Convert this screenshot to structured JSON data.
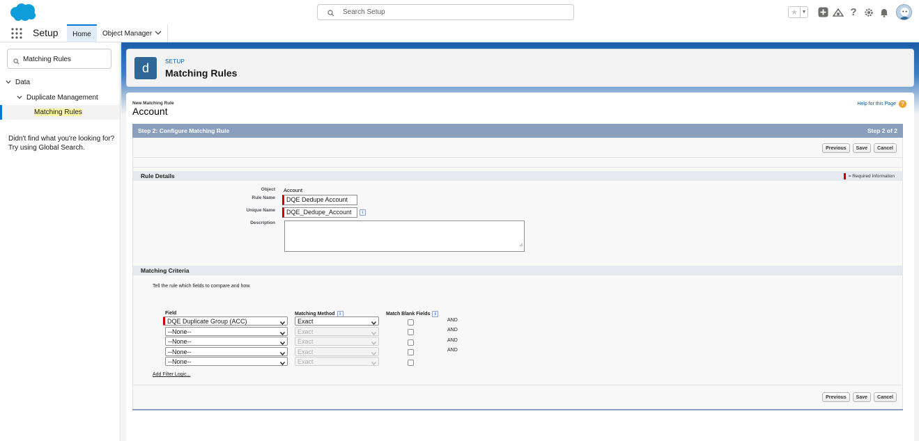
{
  "header": {
    "search_placeholder": "Search Setup"
  },
  "context_bar": {
    "app_name": "Setup",
    "tabs": [
      {
        "label": "Home",
        "active": true
      },
      {
        "label": "Object Manager",
        "active": false
      }
    ]
  },
  "sidebar": {
    "quick_find_value": "Matching Rules",
    "tree": {
      "data_label": "Data",
      "duplicate_management_label": "Duplicate Management",
      "matching_rules_label": "Matching Rules"
    },
    "no_results_help": "Didn't find what you're looking for? Try using Global Search."
  },
  "page_header": {
    "icon_letter": "d",
    "eyebrow": "SETUP",
    "title": "Matching Rules"
  },
  "classic": {
    "subtitle": "New Matching Rule",
    "title": "Account",
    "help_link": "Help for this Page",
    "step_title": "Step 2: Configure Matching Rule",
    "step_count": "Step 2 of 2",
    "buttons": {
      "previous": "Previous",
      "save": "Save",
      "cancel": "Cancel"
    },
    "rule_details": {
      "section_title": "Rule Details",
      "required_legend": "= Required Information",
      "object_label": "Object",
      "object_value": "Account",
      "rule_name_label": "Rule Name",
      "rule_name_value": "DQE Dedupe Account",
      "unique_name_label": "Unique Name",
      "unique_name_value": "DQE_Dedupe_Account",
      "description_label": "Description",
      "description_value": ""
    },
    "matching_criteria": {
      "section_title": "Matching Criteria",
      "intro": "Tell the rule which fields to compare and how.",
      "col_field": "Field",
      "col_method": "Matching Method",
      "col_blank": "Match Blank Fields",
      "rows": [
        {
          "field": "DQE Duplicate Group (ACC)",
          "method": "Exact",
          "match_blank": false,
          "and": "AND"
        },
        {
          "field": "--None--",
          "method": "Exact",
          "match_blank": false,
          "and": "AND"
        },
        {
          "field": "--None--",
          "method": "Exact",
          "match_blank": false,
          "and": "AND"
        },
        {
          "field": "--None--",
          "method": "Exact",
          "match_blank": false,
          "and": "AND"
        },
        {
          "field": "--None--",
          "method": "Exact",
          "match_blank": false,
          "and": ""
        }
      ],
      "add_filter_logic": "Add Filter Logic..."
    }
  },
  "colors": {
    "brand_blue": "#0176d3",
    "header_band": "#1b5faa",
    "step_bar": "#8a9ebe",
    "required_red": "#cc0000",
    "highlight": "#fdf8a8"
  }
}
